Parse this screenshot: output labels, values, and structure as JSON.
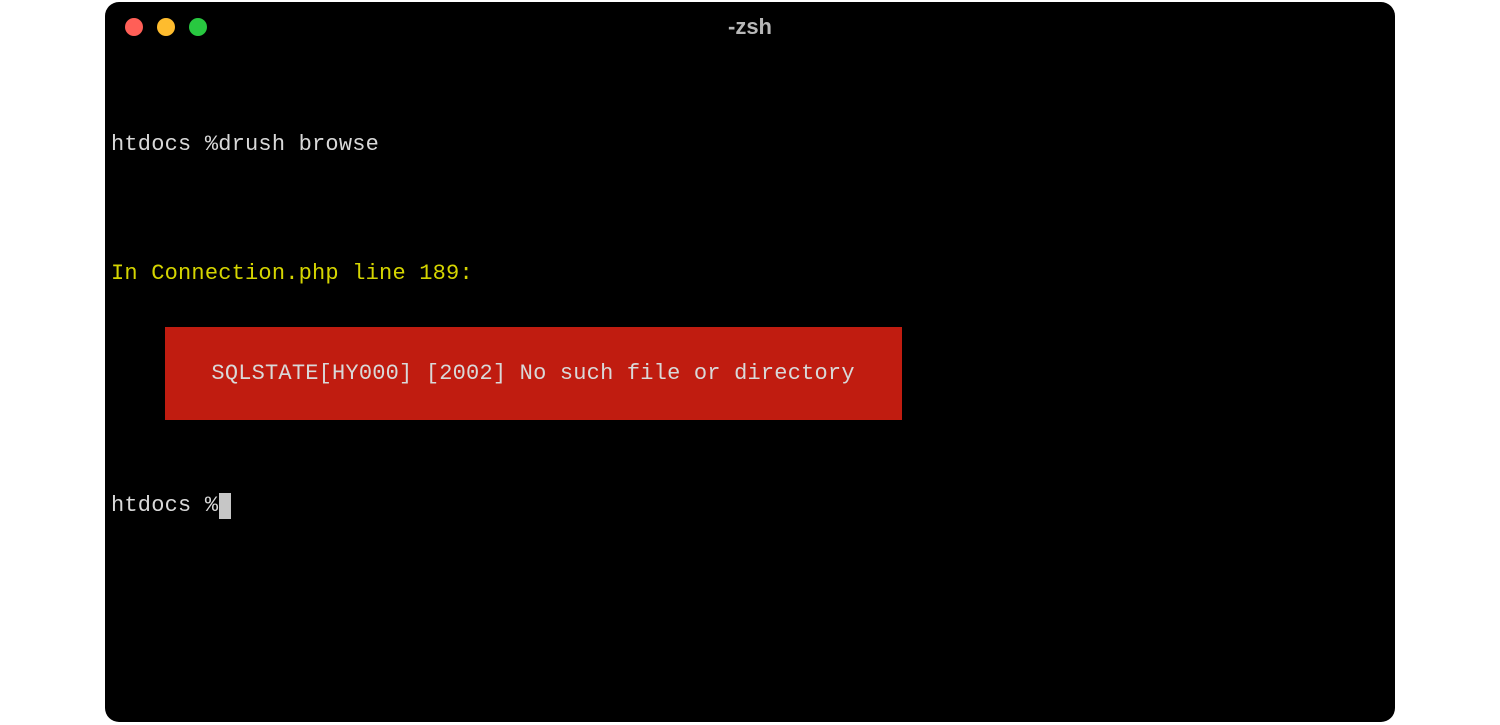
{
  "window": {
    "title": "-zsh"
  },
  "terminal": {
    "line1_prompt": "htdocs %",
    "line1_command": "drush browse",
    "error_location": "In Connection.php line 189:",
    "error_message": "  SQLSTATE[HY000] [2002] No such file or directory  ",
    "line2_prompt": "htdocs %"
  }
}
